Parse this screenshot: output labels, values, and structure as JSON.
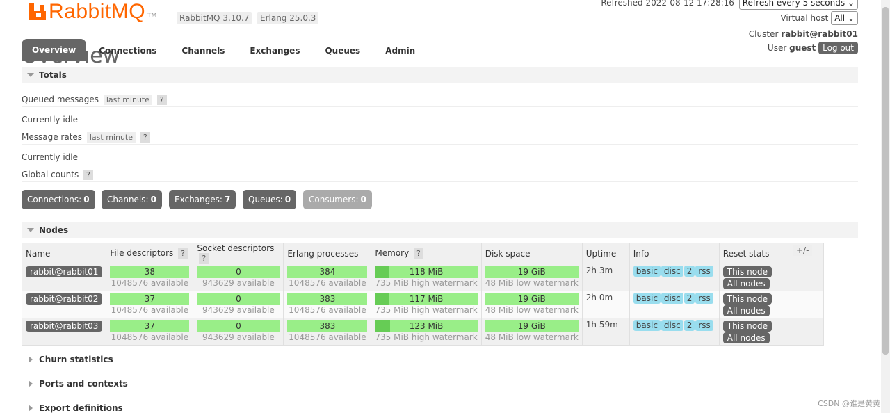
{
  "header": {
    "brand": "RabbitMQ",
    "tm": "TM",
    "rabbitmq_version": "RabbitMQ 3.10.7",
    "erlang_version": "Erlang 25.0.3",
    "refreshed": "Refreshed 2022-08-12 17:28:16",
    "refresh_select": "Refresh every 5 seconds",
    "vhost_label": "Virtual host",
    "vhost_value": "All",
    "cluster_label": "Cluster",
    "cluster_value": "rabbit@rabbit01",
    "user_label": "User",
    "user_value": "guest",
    "logout_label": "Log out"
  },
  "tabs": [
    {
      "label": "Overview",
      "active": true
    },
    {
      "label": "Connections"
    },
    {
      "label": "Channels"
    },
    {
      "label": "Exchanges"
    },
    {
      "label": "Queues"
    },
    {
      "label": "Admin"
    }
  ],
  "page_title": "Overview",
  "totals": {
    "section_label": "Totals",
    "queued_messages_label": "Queued messages",
    "last_minute": "last minute",
    "help": "?",
    "currently_idle": "Currently idle",
    "message_rates_label": "Message rates",
    "global_counts_label": "Global counts"
  },
  "counts": [
    {
      "label": "Connections:",
      "value": "0"
    },
    {
      "label": "Channels:",
      "value": "0"
    },
    {
      "label": "Exchanges:",
      "value": "7"
    },
    {
      "label": "Queues:",
      "value": "0"
    },
    {
      "label": "Consumers:",
      "value": "0"
    }
  ],
  "nodes": {
    "section_label": "Nodes",
    "plus_minus": "+/-",
    "columns": [
      "Name",
      "File descriptors",
      "Socket descriptors",
      "Erlang processes",
      "Memory",
      "Disk space",
      "Uptime",
      "Info",
      "Reset stats"
    ],
    "help": "?",
    "rows": [
      {
        "name": "rabbit@rabbit01",
        "fd": "38",
        "fd_avail": "1048576 available",
        "sd": "0",
        "sd_avail": "943629 available",
        "ep": "384",
        "ep_avail": "1048576 available",
        "mem": "118 MiB",
        "mem_fraction": 0.14,
        "mem_sub": "735 MiB high watermark",
        "disk": "19 GiB",
        "disk_sub": "48 MiB low watermark",
        "uptime": "2h 3m"
      },
      {
        "name": "rabbit@rabbit02",
        "fd": "37",
        "fd_avail": "1048576 available",
        "sd": "0",
        "sd_avail": "943629 available",
        "ep": "383",
        "ep_avail": "1048576 available",
        "mem": "117 MiB",
        "mem_fraction": 0.14,
        "mem_sub": "735 MiB high watermark",
        "disk": "19 GiB",
        "disk_sub": "48 MiB low watermark",
        "uptime": "2h 0m"
      },
      {
        "name": "rabbit@rabbit03",
        "fd": "37",
        "fd_avail": "1048576 available",
        "sd": "0",
        "sd_avail": "943629 available",
        "ep": "383",
        "ep_avail": "1048576 available",
        "mem": "123 MiB",
        "mem_fraction": 0.15,
        "mem_sub": "735 MiB high watermark",
        "disk": "19 GiB",
        "disk_sub": "48 MiB low watermark",
        "uptime": "1h 59m"
      }
    ],
    "info_tags": [
      "basic",
      "disc",
      "2",
      "rss"
    ],
    "reset_this": "This node",
    "reset_all": "All nodes"
  },
  "collapsed_sections": [
    "Churn statistics",
    "Ports and contexts",
    "Export definitions"
  ],
  "watermark": "CSDN @谁是黄黄"
}
